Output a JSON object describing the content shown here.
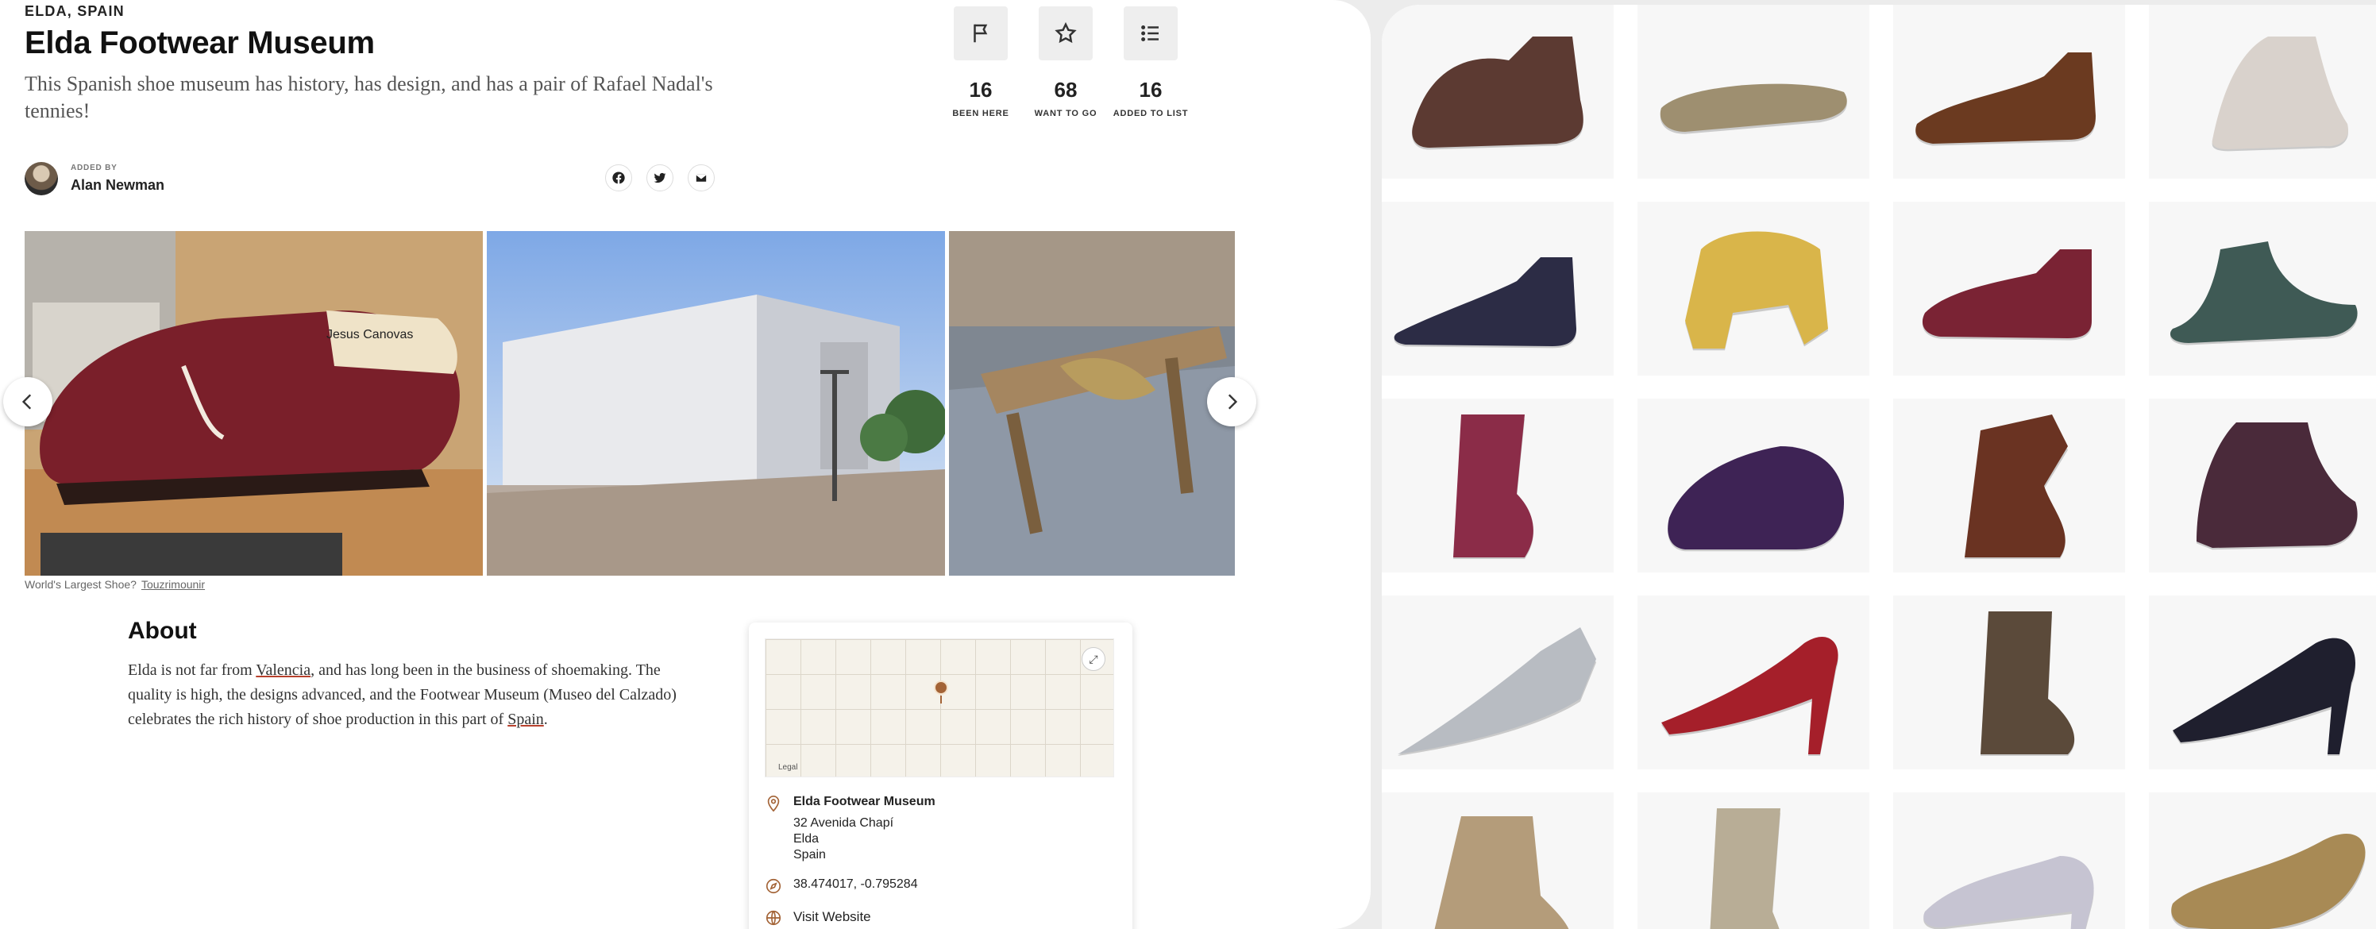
{
  "place": {
    "location": "ELDA, SPAIN",
    "title": "Elda Footwear Museum",
    "subtitle": "This Spanish shoe museum has history, has design, and has a pair of Rafael Nadal's tennies!"
  },
  "stats": [
    {
      "count": "16",
      "label": "BEEN HERE",
      "icon": "flag-icon"
    },
    {
      "count": "68",
      "label": "WANT TO GO",
      "icon": "star-icon"
    },
    {
      "count": "16",
      "label": "ADDED TO LIST",
      "icon": "list-icon"
    }
  ],
  "author": {
    "added_by_label": "ADDED BY",
    "name": "Alan Newman"
  },
  "share": [
    "facebook-icon",
    "twitter-icon",
    "email-icon"
  ],
  "gallery": {
    "caption": "World's Largest Shoe?",
    "credit": "Touzrimounir",
    "shoe_label": "Jesus Canovas"
  },
  "about": {
    "heading": "About",
    "p1": "Elda is not far from ",
    "link1": "Valencia",
    "p2": ", and has long been in the business of shoemaking. The quality is high, the designs advanced, and the Footwear Museum (Museo del Calzado) celebrates the rich history of shoe production in this part of ",
    "link2": "Spain",
    "p3": "."
  },
  "map": {
    "legal": "Legal",
    "place_name": "Elda Footwear Museum",
    "address_line1": "32 Avenida Chapí",
    "address_line2": "Elda",
    "address_line3": "Spain",
    "coordinates": "38.474017, -0.795284",
    "website_label": "Visit Website"
  },
  "colors": {
    "accent": "#a36336",
    "link_underline": "#b7412d",
    "panel_bg": "#ffffff",
    "page_bg": "#ececec"
  },
  "shoes": [
    {
      "name": "brown-leather-ankle-boot",
      "color": "#5c3a32"
    },
    {
      "name": "woven-straw-sandal",
      "color": "#9e8f70"
    },
    {
      "name": "brown-pointed-slipper",
      "color": "#6b3a20"
    },
    {
      "name": "embroidered-buckle-shoe",
      "color": "#d9d2cc"
    },
    {
      "name": "navy-pointed-shoe",
      "color": "#2c2c45"
    },
    {
      "name": "yellow-platform-shoe",
      "color": "#d9b54a"
    },
    {
      "name": "maroon-velvet-slipper",
      "color": "#7a2334"
    },
    {
      "name": "green-curled-toe-boot",
      "color": "#3f5a55"
    },
    {
      "name": "red-lace-up-boot",
      "color": "#8b2c48"
    },
    {
      "name": "purple-platform-mule",
      "color": "#3e2355"
    },
    {
      "name": "brown-cavalier-boot",
      "color": "#6a3322"
    },
    {
      "name": "embroidered-ankle-boot",
      "color": "#4a2a3a"
    },
    {
      "name": "silver-armor-sabaton",
      "color": "#b8bcc2"
    },
    {
      "name": "red-stiletto-pump",
      "color": "#a51f2a"
    },
    {
      "name": "brown-button-boot",
      "color": "#5b4a3a"
    },
    {
      "name": "black-white-heeled-shoe",
      "color": "#1f1f2e"
    },
    {
      "name": "beige-button-boot",
      "color": "#b49c7a"
    },
    {
      "name": "grey-lace-up-boot",
      "color": "#b8ad96"
    },
    {
      "name": "silver-t-strap-heel",
      "color": "#c6c4d2"
    },
    {
      "name": "straw-curled-slipper",
      "color": "#a88a55"
    }
  ]
}
